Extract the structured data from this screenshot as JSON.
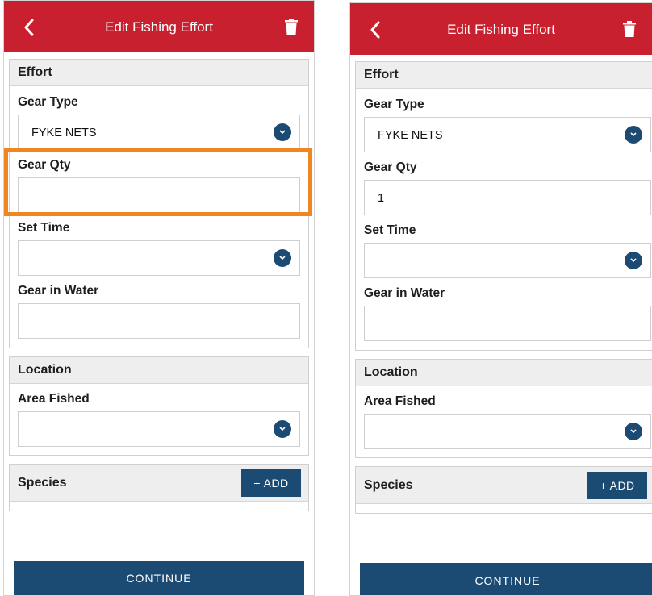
{
  "screens": [
    {
      "header": {
        "title": "Edit Fishing Effort"
      },
      "effort": {
        "title": "Effort",
        "gear_type_label": "Gear Type",
        "gear_type_value": "FYKE NETS",
        "gear_qty_label": "Gear Qty",
        "gear_qty_value": "",
        "set_time_label": "Set Time",
        "set_time_value": "",
        "gear_in_water_label": "Gear in Water",
        "gear_in_water_value": ""
      },
      "location": {
        "title": "Location",
        "area_fished_label": "Area Fished",
        "area_fished_value": ""
      },
      "species": {
        "title": "Species",
        "add_label": "+ ADD"
      },
      "continue_label": "CONTINUE"
    },
    {
      "header": {
        "title": "Edit Fishing Effort"
      },
      "effort": {
        "title": "Effort",
        "gear_type_label": "Gear Type",
        "gear_type_value": "FYKE NETS",
        "gear_qty_label": "Gear Qty",
        "gear_qty_value": "1",
        "set_time_label": "Set Time",
        "set_time_value": "",
        "gear_in_water_label": "Gear in Water",
        "gear_in_water_value": ""
      },
      "location": {
        "title": "Location",
        "area_fished_label": "Area Fished",
        "area_fished_value": ""
      },
      "species": {
        "title": "Species",
        "add_label": "+ ADD"
      },
      "continue_label": "CONTINUE"
    }
  ],
  "colors": {
    "header_red": "#c9202f",
    "primary_blue": "#1b4a73",
    "highlight_orange": "#ef8523"
  },
  "icons": {
    "back": "chevron-left-icon",
    "delete": "trash-icon",
    "dropdown": "chevron-down-icon"
  }
}
